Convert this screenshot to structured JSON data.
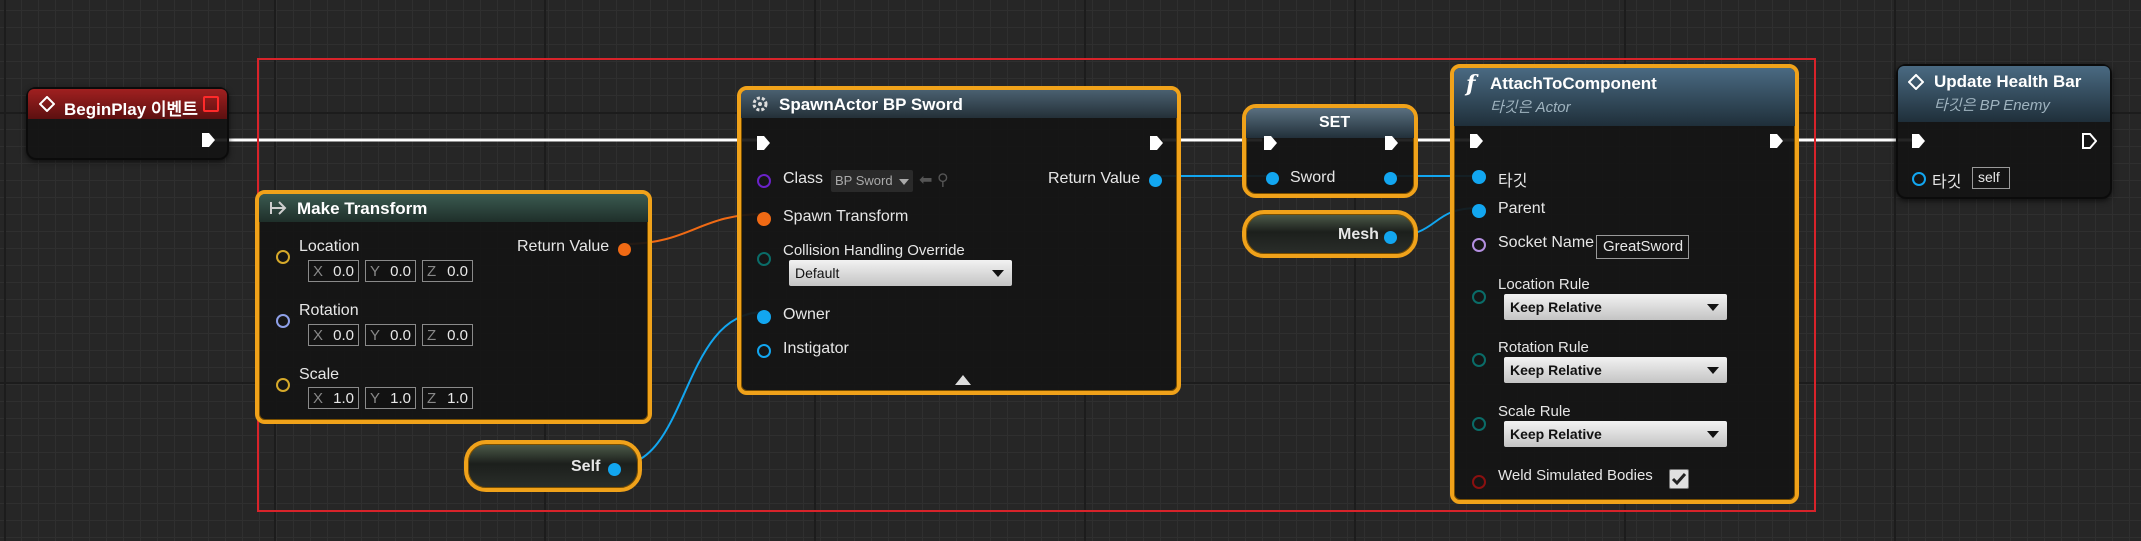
{
  "colors": {
    "selection": "#f0a21a",
    "comment_border": "#d8232a",
    "exec_wire": "#ffffff",
    "object_pin": "#12a6f0",
    "struct_pin": "#f06a14",
    "class_pin": "#6a22c8",
    "vector_pin": "#d6a92a",
    "rotator_pin": "#8ea0e8",
    "bool_pin": "#8a1010",
    "enum_pin": "#0a6c68",
    "name_pin": "#b38fe0",
    "event_header": "#8c1a1a",
    "function_header": "#3b5a70"
  },
  "begin_play": {
    "title": "BeginPlay 이벤트",
    "icon": "event-diamond-icon"
  },
  "make_transform": {
    "title": "Make Transform",
    "icon": "make-struct-icon",
    "location_label": "Location",
    "rotation_label": "Rotation",
    "scale_label": "Scale",
    "return_label": "Return Value",
    "location": [
      {
        "axis": "X",
        "value": "0.0"
      },
      {
        "axis": "Y",
        "value": "0.0"
      },
      {
        "axis": "Z",
        "value": "0.0"
      }
    ],
    "rotation": [
      {
        "axis": "X",
        "value": "0.0"
      },
      {
        "axis": "Y",
        "value": "0.0"
      },
      {
        "axis": "Z",
        "value": "0.0"
      }
    ],
    "scale": [
      {
        "axis": "X",
        "value": "1.0"
      },
      {
        "axis": "Y",
        "value": "1.0"
      },
      {
        "axis": "Z",
        "value": "1.0"
      }
    ]
  },
  "spawn_actor": {
    "title": "SpawnActor BP Sword",
    "icon": "spawn-gear-icon",
    "class_label": "Class",
    "class_value": "BP Sword",
    "return_label": "Return Value",
    "spawn_transform_label": "Spawn Transform",
    "collision_label": "Collision Handling Override",
    "collision_value": "Default",
    "owner_label": "Owner",
    "instigator_label": "Instigator"
  },
  "self_node": {
    "label": "Self"
  },
  "set_node": {
    "title": "SET",
    "var_label": "Sword"
  },
  "mesh_node": {
    "label": "Mesh"
  },
  "attach": {
    "title": "AttachToComponent",
    "subtitle": "타깃은 Actor",
    "icon": "function-f-icon",
    "target_label": "타깃",
    "parent_label": "Parent",
    "socket_label": "Socket Name",
    "socket_value": "GreatSword",
    "location_rule_label": "Location Rule",
    "location_rule_value": "Keep Relative",
    "rotation_rule_label": "Rotation Rule",
    "rotation_rule_value": "Keep Relative",
    "scale_rule_label": "Scale Rule",
    "scale_rule_value": "Keep Relative",
    "weld_label": "Weld Simulated Bodies",
    "weld_checked": true
  },
  "update_health": {
    "title": "Update Health Bar",
    "subtitle": "타깃은 BP Enemy",
    "icon": "event-diamond-icon",
    "target_label": "타깃",
    "target_value": "self"
  }
}
